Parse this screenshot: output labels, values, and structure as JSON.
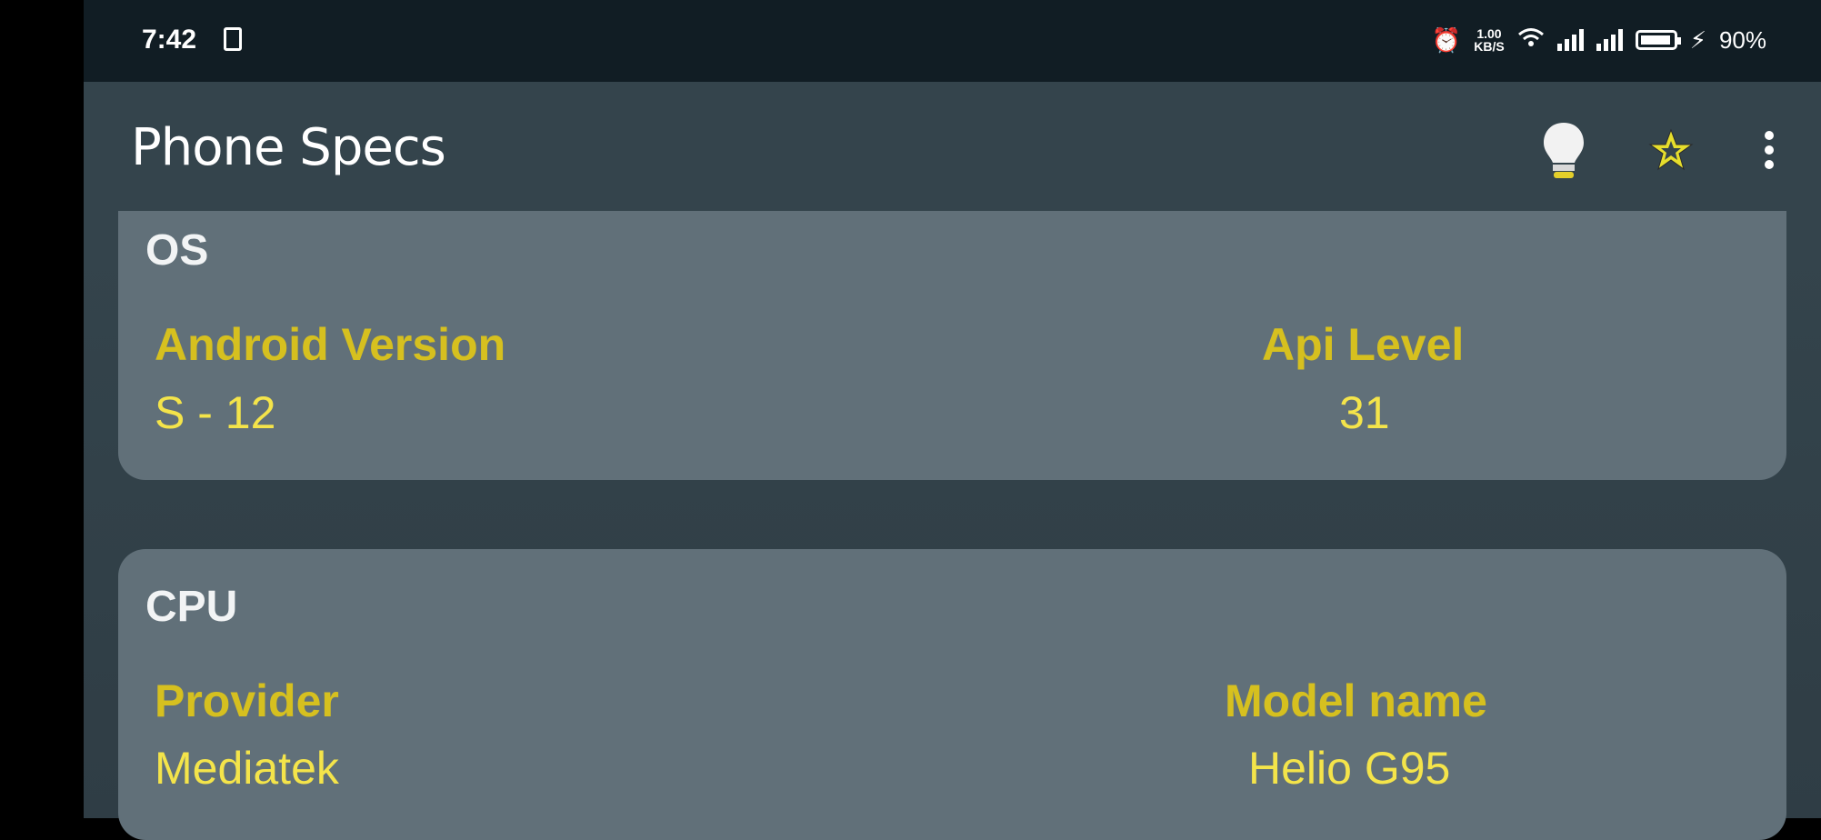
{
  "status_bar": {
    "time": "7:42",
    "battery_percent": "90%",
    "net_speed_top": "1.00",
    "net_speed_bottom": "KB/S"
  },
  "appbar": {
    "title": "Phone Specs",
    "icons": [
      "lightbulb-icon",
      "star-icon",
      "more-vert-icon"
    ],
    "colors": {
      "bulb": "#f2f2f2",
      "bulb_base": "#e3cf2a",
      "star": "#e6de2c"
    }
  },
  "cards": {
    "os": {
      "title": "OS",
      "android_version_label": "Android Version",
      "android_version_value": "S - 12",
      "api_level_label": "Api Level",
      "api_level_value": "31"
    },
    "cpu": {
      "title": "CPU",
      "provider_label": "Provider",
      "provider_value": "Mediatek",
      "model_label": "Model name",
      "model_value": "Helio G95"
    }
  },
  "colors": {
    "label": "#d6c01f",
    "value": "#f4e44a",
    "card": "#617079",
    "appbar": "#34444c",
    "status_bar": "#111d24"
  }
}
